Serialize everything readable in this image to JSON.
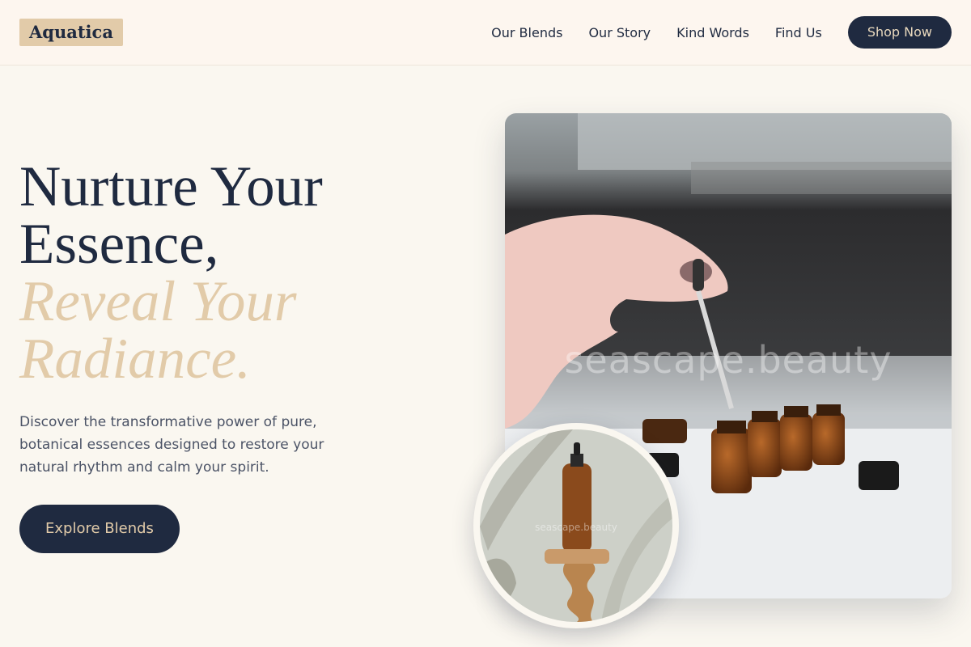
{
  "brand": {
    "name": "Aquatica"
  },
  "nav": {
    "links": [
      "Our Blends",
      "Our Story",
      "Kind Words",
      "Find Us"
    ],
    "cta": "Shop Now"
  },
  "hero": {
    "title_line_1": "Nurture Your",
    "title_line_2": "Essence,",
    "accent_line_1": "Reveal Your",
    "accent_line_2": "Radiance.",
    "description": "Discover the transformative power of pure, botanical essences designed to restore your natural rhythm and calm your spirit.",
    "cta": "Explore Blends"
  },
  "images": {
    "main_watermark": "seascape.beauty",
    "circle_watermark": "seascape.beauty"
  },
  "colors": {
    "navy": "#1f2a40",
    "sand": "#e2cba9",
    "cream": "#faf7f0"
  }
}
